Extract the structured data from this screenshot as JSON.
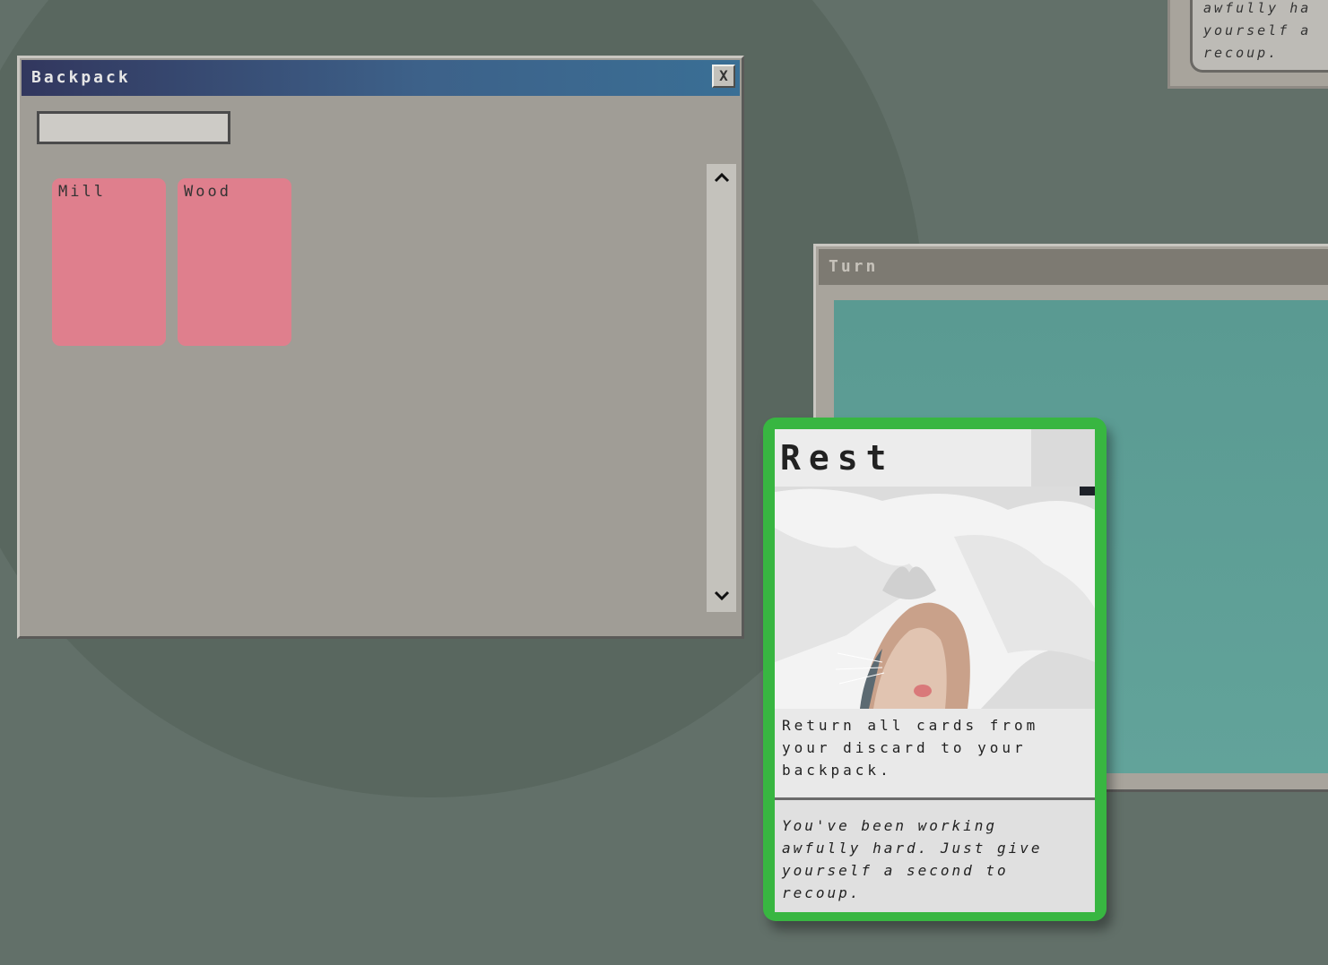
{
  "backpack_window": {
    "title": "Backpack",
    "close_label": "X",
    "search_value": "",
    "cards": [
      {
        "name": "Mill",
        "color": "#df7f8d"
      },
      {
        "name": "Wood",
        "color": "#df7f8d"
      }
    ]
  },
  "turn_window": {
    "title": "Turn"
  },
  "background_window": {
    "text": "awfully ha\nyourself a\nrecoup."
  },
  "card": {
    "title": "Rest",
    "description": "Return all cards from your discard to your backpack.",
    "flavor": "You've been working awfully hard. Just give yourself a second to recoup.",
    "border_color": "#38b641",
    "image": "cat-under-blanket"
  },
  "colors": {
    "desktop": "#627069",
    "titlebar_active_start": "#32375e",
    "titlebar_active_end": "#3a6f95",
    "turn_panel": "#62a39a"
  }
}
